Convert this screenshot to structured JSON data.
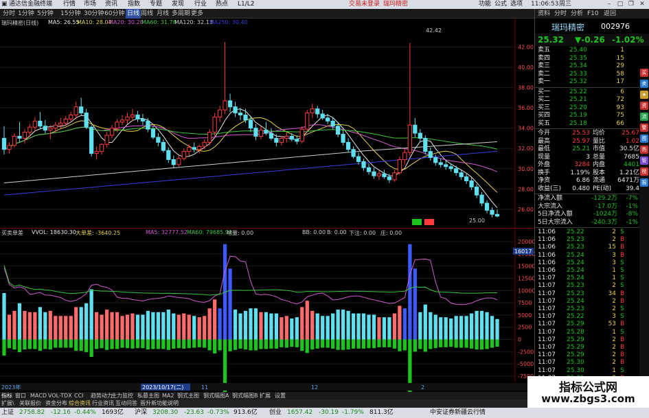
{
  "app": {
    "title": "通达信金融终端",
    "menu": [
      "行情",
      "市场",
      "资讯",
      "指数",
      "专题",
      "发现",
      "行业",
      "热点",
      "L1/L2"
    ],
    "trade_buttons": [
      "交易未登录",
      "瑞玛精密"
    ],
    "right_menu": [
      "功能",
      "公式",
      "选项"
    ],
    "clock": "11:06:53",
    "weekday": "周三"
  },
  "period_tabs": [
    "分时",
    "1分钟",
    "5分钟",
    "15分钟",
    "30分钟",
    "60分钟",
    "日线",
    "周线",
    "月线",
    "多周期",
    "更多"
  ],
  "active_period": "日线",
  "right_tabs": [
    "资料",
    "分时",
    "分析",
    "F10",
    "返回"
  ],
  "stock": {
    "name": "瑞玛精密",
    "code": "002976",
    "price": "25.32",
    "change": "▼-0.26",
    "pct": "-1.02%"
  },
  "chart_header": {
    "stock_label": "瑞玛精密(日线)",
    "ma5": "MA5: 26.55",
    "ma10": "MA10: 28.04",
    "ma20": "MA20: 30.28",
    "ma60": "MA60: 31.78",
    "ma120": "MA120: 32.13",
    "ma250": "MA250: 30.40"
  },
  "volume_header": {
    "label": "买卖单差",
    "vol": "VVOL: 18630.30",
    "big": "大单差: -3640.25",
    "vma5": "MA5: 32777.52",
    "vma60": "MA60: 79685.92",
    "diff": "地量: 0.00",
    "sig1": "BB: 0.00",
    "sig2": "B: 0.00",
    "sig3": "下注: 0.00",
    "sig4": "庄: 0.00"
  },
  "colors": {
    "up": "#ff3c3c",
    "down": "#5fe0f0",
    "ma5": "#e6e6e6",
    "ma10": "#e6d24a",
    "ma20": "#d25ad2",
    "ma60": "#3cc83c",
    "ma120": "#cfcfcf",
    "ma250": "#3c3cdc"
  },
  "chart_annotations": {
    "high": "42.42",
    "low": "25.00",
    "side_value": "16017"
  },
  "price_axis": [
    "42.00",
    "40.00",
    "38.00",
    "36.00",
    "34.00",
    "32.00",
    "30.00",
    "28.00",
    "26.00"
  ],
  "volume_axis": [
    "20000",
    "17500",
    "15000",
    "12500",
    "10000",
    "7500",
    "5000",
    "2500",
    "0",
    "-2500",
    "-5000",
    "-7500"
  ],
  "date_labels": [
    "2023年",
    "2023/10/17(二)",
    "11",
    "12",
    "2"
  ],
  "order_book": {
    "asks": [
      {
        "label": "卖五",
        "price": "25.40",
        "vol": "1"
      },
      {
        "label": "卖四",
        "price": "25.35",
        "vol": "15"
      },
      {
        "label": "卖三",
        "price": "25.34",
        "vol": "29"
      },
      {
        "label": "卖二",
        "price": "25.33",
        "vol": "58"
      },
      {
        "label": "卖一",
        "price": "25.32",
        "vol": "17"
      }
    ],
    "bids": [
      {
        "label": "买一",
        "price": "25.22",
        "vol": "6"
      },
      {
        "label": "买二",
        "price": "25.21",
        "vol": "72"
      },
      {
        "label": "买三",
        "price": "25.20",
        "vol": "93"
      },
      {
        "label": "买四",
        "price": "25.19",
        "vol": "75"
      },
      {
        "label": "买五",
        "price": "25.18",
        "vol": "66"
      }
    ]
  },
  "quote": [
    {
      "l1": "今开",
      "v1": "25.53",
      "l2": "均价",
      "v2": "25.67"
    },
    {
      "l1": "最高",
      "v1": "25.97",
      "l2": "量比",
      "v2": "1.02"
    },
    {
      "l1": "最低",
      "v1": "25.21",
      "l2": "市值",
      "v2": "30.5亿"
    },
    {
      "l1": "现量",
      "v1": "3",
      "l2": "总量",
      "v2": "7685"
    },
    {
      "l1": "外盘",
      "v1": "3284",
      "l2": "内盘",
      "v2": "4401"
    },
    {
      "l1": "换手",
      "v1": "1.19%",
      "l2": "股本",
      "v2": "1.21亿"
    },
    {
      "l1": "净资",
      "v1": "6.86",
      "l2": "流通",
      "v2": "6471万"
    },
    {
      "l1": "收益(三)",
      "v1": "0.480",
      "l2": "PE(动)",
      "v2": "39.4"
    }
  ],
  "flow": [
    {
      "label": "净流入额",
      "val": "-129.2万",
      "pct": "-7%"
    },
    {
      "label": "大宗流入",
      "val": "-17.0万",
      "pct": "-1%"
    },
    {
      "label": "5日净流入额",
      "val": "-1024万",
      "pct": "-8%"
    },
    {
      "label": "5日大宗流入",
      "val": "-240.3万",
      "pct": "-1%"
    }
  ],
  "ticks": [
    {
      "t": "11:06",
      "p": "25.22",
      "v": "2",
      "s": "S"
    },
    {
      "t": "11:06",
      "p": "25.23",
      "v": "2",
      "s": "B"
    },
    {
      "t": "11:06",
      "p": "25.23",
      "v": "15",
      "s": "B"
    },
    {
      "t": "11:06",
      "p": "25.24",
      "v": "3",
      "s": "B"
    },
    {
      "t": "11:06",
      "p": "25.24",
      "v": "3",
      "s": "S"
    },
    {
      "t": "11:06",
      "p": "25.24",
      "v": "1",
      "s": "S"
    },
    {
      "t": "11:07",
      "p": "25.24",
      "v": "1",
      "s": "S"
    },
    {
      "t": "11:07",
      "p": "25.23",
      "v": "2",
      "s": "S"
    },
    {
      "t": "11:07",
      "p": "25.23",
      "v": "34",
      "s": "B"
    },
    {
      "t": "11:07",
      "p": "25.24",
      "v": "2",
      "s": "B"
    },
    {
      "t": "11:07",
      "p": "25.23",
      "v": "2",
      "s": "S"
    },
    {
      "t": "11:07",
      "p": "25.22",
      "v": "3",
      "s": "S"
    },
    {
      "t": "11:07",
      "p": "25.29",
      "v": "53",
      "s": "B"
    },
    {
      "t": "11:07",
      "p": "25.28",
      "v": "1",
      "s": "S"
    },
    {
      "t": "11:07",
      "p": "25.29",
      "v": "2",
      "s": "B"
    },
    {
      "t": "11:07",
      "p": "25.29",
      "v": "2",
      "s": "B"
    },
    {
      "t": "11:07",
      "p": "25.29",
      "v": "2",
      "s": "B"
    },
    {
      "t": "11:07",
      "p": "25.30",
      "v": "2",
      "s": "B"
    },
    {
      "t": "11:07",
      "p": "25.30",
      "v": "1",
      "s": "S"
    },
    {
      "t": "11:07",
      "p": "25.31",
      "v": "2",
      "s": "B"
    },
    {
      "t": "11:07",
      "p": "25.32",
      "v": "2",
      "s": "B"
    },
    {
      "t": "11:07",
      "p": "25.32",
      "v": "3",
      "s": "B"
    }
  ],
  "indicator_tabs": [
    "指标",
    "窗口",
    "MACD",
    "VOL-TDX",
    "CCI",
    "趋势动力",
    "主力监控",
    "私募主图",
    "MA2",
    "钢式主图",
    "钢式幅图A",
    "钢式幅图B",
    "扩展",
    "设置"
  ],
  "sub_status": [
    "扩展\\",
    "关联报价",
    "资金分布",
    "综合资讯",
    "行业资讯",
    "互动问答",
    "晋升新功能说明"
  ],
  "status": {
    "sh_label": "上证",
    "sh": "2758.82",
    "sh_chg": "-12.16",
    "sh_pct": "-0.44%",
    "sh_amt": "1693亿",
    "sz_label": "沪深",
    "sz": "3208.30",
    "sz_chg": "-23.63",
    "sz_pct": "-0.73%",
    "sz_amt": "913.6亿",
    "cy_label": "创业",
    "cy": "1657.42",
    "cy_chg": "-30.19",
    "cy_pct": "-1.79%",
    "cy_amt": "811.3亿",
    "broker": "中安证券新疆云行情"
  },
  "watermark": {
    "line1": "指标公式网",
    "line2": "www.zbgs3.com"
  },
  "kline": [
    [
      33.0,
      34.2,
      31.4,
      31.9
    ],
    [
      31.9,
      32.6,
      31.5,
      32.3
    ],
    [
      32.3,
      33.5,
      32.1,
      33.2
    ],
    [
      33.2,
      34.6,
      32.6,
      33.0
    ],
    [
      33.0,
      33.9,
      32.5,
      33.6
    ],
    [
      33.6,
      34.4,
      33.1,
      34.1
    ],
    [
      34.1,
      35.1,
      33.8,
      34.7
    ],
    [
      34.7,
      35.6,
      33.9,
      34.2
    ],
    [
      34.2,
      34.8,
      33.5,
      33.8
    ],
    [
      33.8,
      34.3,
      32.9,
      34.0
    ],
    [
      34.0,
      34.6,
      33.6,
      34.3
    ],
    [
      34.3,
      35.0,
      34.0,
      34.5
    ],
    [
      34.5,
      35.2,
      34.2,
      34.9
    ],
    [
      34.9,
      35.6,
      34.6,
      35.3
    ],
    [
      35.3,
      36.6,
      34.9,
      36.1
    ],
    [
      36.1,
      37.0,
      35.3,
      35.5
    ],
    [
      35.5,
      35.9,
      33.9,
      34.1
    ],
    [
      34.1,
      34.3,
      31.2,
      31.5
    ],
    [
      31.5,
      32.2,
      30.9,
      31.7
    ],
    [
      31.7,
      32.5,
      31.4,
      32.4
    ],
    [
      32.4,
      33.6,
      32.1,
      33.3
    ],
    [
      33.3,
      34.3,
      33.0,
      34.0
    ],
    [
      34.0,
      34.9,
      33.6,
      34.6
    ],
    [
      34.6,
      35.3,
      34.3,
      34.8
    ],
    [
      34.8,
      35.5,
      34.4,
      35.1
    ],
    [
      35.1,
      35.9,
      34.7,
      35.3
    ],
    [
      35.3,
      35.7,
      34.6,
      34.9
    ],
    [
      34.9,
      35.4,
      34.3,
      34.7
    ],
    [
      34.7,
      35.0,
      33.6,
      33.9
    ],
    [
      33.9,
      34.2,
      32.9,
      33.1
    ],
    [
      33.1,
      33.5,
      32.2,
      32.6
    ],
    [
      32.6,
      32.9,
      31.6,
      31.8
    ],
    [
      31.8,
      32.1,
      30.6,
      30.9
    ],
    [
      30.9,
      31.3,
      30.1,
      30.4
    ],
    [
      30.4,
      31.3,
      30.2,
      31.0
    ],
    [
      31.0,
      32.0,
      30.8,
      31.7
    ],
    [
      31.7,
      32.4,
      31.3,
      32.1
    ],
    [
      32.1,
      32.6,
      31.6,
      31.9
    ],
    [
      31.9,
      32.4,
      31.5,
      32.2
    ],
    [
      32.2,
      32.9,
      31.9,
      32.6
    ],
    [
      32.6,
      33.9,
      32.3,
      33.6
    ],
    [
      33.6,
      35.5,
      33.2,
      35.1
    ],
    [
      35.1,
      36.2,
      34.6,
      35.8
    ],
    [
      35.8,
      42.5,
      35.4,
      36.7
    ],
    [
      36.7,
      37.4,
      35.6,
      36.1
    ],
    [
      36.1,
      36.6,
      35.1,
      35.5
    ],
    [
      35.5,
      36.0,
      34.8,
      35.3
    ],
    [
      35.3,
      35.9,
      34.5,
      34.8
    ],
    [
      34.8,
      35.2,
      33.6,
      34.0
    ],
    [
      34.0,
      34.4,
      32.8,
      33.2
    ],
    [
      33.2,
      34.2,
      32.9,
      33.8
    ],
    [
      33.8,
      34.6,
      33.3,
      33.5
    ],
    [
      33.5,
      34.0,
      32.8,
      33.0
    ],
    [
      33.0,
      33.4,
      32.2,
      32.6
    ],
    [
      32.6,
      33.2,
      32.3,
      33.0
    ],
    [
      33.0,
      33.6,
      32.6,
      33.2
    ],
    [
      33.2,
      33.5,
      32.7,
      32.9
    ],
    [
      32.9,
      33.3,
      32.4,
      32.7
    ],
    [
      32.7,
      34.2,
      32.5,
      33.9
    ],
    [
      33.9,
      35.8,
      33.6,
      35.5
    ],
    [
      35.5,
      36.4,
      35.0,
      35.9
    ],
    [
      35.9,
      36.2,
      35.0,
      35.4
    ],
    [
      35.4,
      35.8,
      34.8,
      35.0
    ],
    [
      35.0,
      35.4,
      34.4,
      34.7
    ],
    [
      34.7,
      35.1,
      33.9,
      34.2
    ],
    [
      34.2,
      34.6,
      33.1,
      33.4
    ],
    [
      33.4,
      33.8,
      32.3,
      32.6
    ],
    [
      32.6,
      33.0,
      31.6,
      31.9
    ],
    [
      31.9,
      32.2,
      31.0,
      31.2
    ],
    [
      31.2,
      31.6,
      30.4,
      30.7
    ],
    [
      30.7,
      31.0,
      29.8,
      30.1
    ],
    [
      30.1,
      30.5,
      29.4,
      29.7
    ],
    [
      29.7,
      30.1,
      29.0,
      29.3
    ],
    [
      29.3,
      29.8,
      28.9,
      29.5
    ],
    [
      29.5,
      29.9,
      29.0,
      29.2
    ],
    [
      29.2,
      29.5,
      28.6,
      28.9
    ],
    [
      28.9,
      29.9,
      28.7,
      29.6
    ],
    [
      29.6,
      31.2,
      29.4,
      30.9
    ],
    [
      30.9,
      32.0,
      30.4,
      31.6
    ],
    [
      31.6,
      42.42,
      31.3,
      34.3
    ],
    [
      34.3,
      35.0,
      33.1,
      33.5
    ],
    [
      33.5,
      33.9,
      32.6,
      33.0
    ],
    [
      33.0,
      33.3,
      31.4,
      31.7
    ],
    [
      31.7,
      32.1,
      30.8,
      31.1
    ],
    [
      31.1,
      31.4,
      30.3,
      30.6
    ],
    [
      30.6,
      31.0,
      30.1,
      30.4
    ],
    [
      30.4,
      30.8,
      29.9,
      30.2
    ],
    [
      30.2,
      30.5,
      29.7,
      30.0
    ],
    [
      30.0,
      30.3,
      29.3,
      29.6
    ],
    [
      29.6,
      29.9,
      28.9,
      29.2
    ],
    [
      29.2,
      29.5,
      28.5,
      28.8
    ],
    [
      28.8,
      29.1,
      27.9,
      28.2
    ],
    [
      28.2,
      28.5,
      27.1,
      27.4
    ],
    [
      27.4,
      27.7,
      26.3,
      26.6
    ],
    [
      26.6,
      26.9,
      25.6,
      25.9
    ],
    [
      25.9,
      26.2,
      25.2,
      25.5
    ],
    [
      25.5,
      25.97,
      25.21,
      25.32
    ]
  ]
}
